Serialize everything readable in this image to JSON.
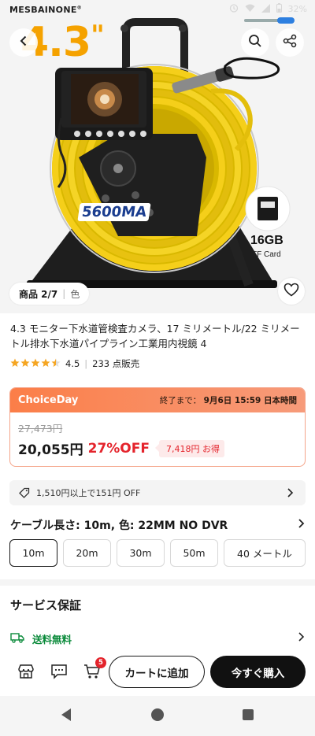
{
  "status_bar": {
    "brand": "MESBAINONE",
    "brand_mark": "®",
    "battery": "32%"
  },
  "hero": {
    "size_text": "4.3",
    "size_quote": "\"",
    "battery_label": "5600MA",
    "card_size": "16GB",
    "card_type": "TF Card",
    "image_counter_label": "商品 2/7",
    "color_tab": "色"
  },
  "product": {
    "title": "4.3 モニター下水道管検査カメラ、17 ミリメートル/22 ミリメートル排水下水道パイプライン工業用内視鏡 4",
    "rating": "4.5",
    "sold": "233 点販売",
    "stars": 4.5
  },
  "promo": {
    "name": "ChoiceDay",
    "ends_label": "終了まで：",
    "ends_value": "9月6日 15:59 日本時間",
    "original_price": "27,473円",
    "price": "20,055円",
    "discount": "27%OFF",
    "savings": "7,418円 お得"
  },
  "coupon": {
    "text": "1,510円以上で151円 OFF"
  },
  "variant": {
    "label": "ケーブル長さ: 10m, 色: 22MM NO DVR",
    "options": [
      "10m",
      "20m",
      "30m",
      "50m",
      "40 メートル"
    ],
    "selected": "10m"
  },
  "service": {
    "title": "サービス保証",
    "shipping": "送料無料"
  },
  "action_bar": {
    "cart_count": "5",
    "add_to_cart": "カートに追加",
    "buy_now": "今すぐ購入"
  },
  "colors": {
    "accent_red": "#e4242c",
    "promo_orange": "#fb7e48",
    "star": "#f5a623",
    "shipping_green": "#0a8a3a",
    "cable_yellow": "#f5cf1a"
  }
}
